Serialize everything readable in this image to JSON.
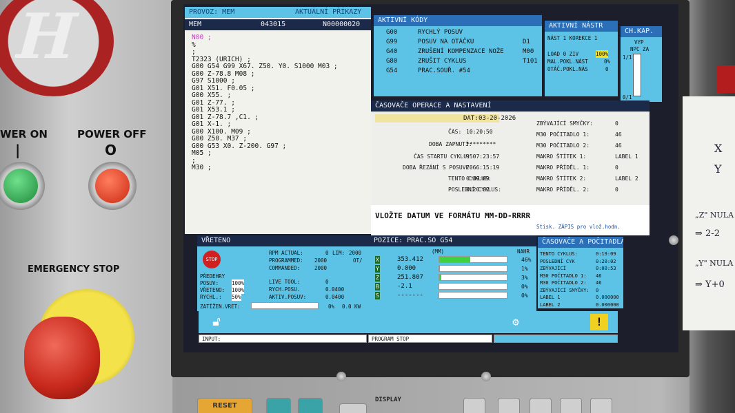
{
  "machine_panel": {
    "power_on_label": "WER ON",
    "power_on_symbol": "|",
    "power_off_label": "POWER OFF",
    "power_off_symbol": "O",
    "emergency_stop_label": "EMERGENCY STOP"
  },
  "program": {
    "mode_header": "PROVOZ: MEM",
    "mode_header_right": "AKTUÁLNÍ PŘÍKAZY",
    "bar_left": "MEM",
    "program_number": "043015",
    "sequence": "N00000020",
    "lines": [
      "N00 ;",
      "%",
      ";",
      "T2323 (URICH) ;",
      "G00 G54 G99 X67. Z50. Y0. S1000 M03 ;",
      "G00 Z-78.8 M08 ;",
      "G97 S1000 ;",
      "G01 X51. F0.05 ;",
      "G00 X55. ;",
      "G01 Z-77. ;",
      "G01 X53.1 ;",
      "G01 Z-78.7 ,C1. ;",
      "G01 X-1. ;",
      "G00 X100. M09 ;",
      "G00 Z50. M37 ;",
      "G00 G53 X0. Z-200. G97 ;",
      "M05 ;",
      ";",
      "M30 ;"
    ]
  },
  "active_codes": {
    "title": "AKTIVNÍ KÓDY",
    "rows": [
      {
        "code": "G00",
        "desc": "RYCHLÝ POSUV",
        "extra": ""
      },
      {
        "code": "G99",
        "desc": "POSUV NA OTÁČKU",
        "extra": "D1"
      },
      {
        "code": "G40",
        "desc": "ZRUŠENÍ KOMPENZACE NOŽE",
        "extra": "M00"
      },
      {
        "code": "G80",
        "desc": "ZRUŠIT CYKLUS",
        "extra": "T101"
      },
      {
        "code": "G54",
        "desc": "PRAC.SOUŘ. #54",
        "extra": ""
      }
    ]
  },
  "active_tool": {
    "title": "AKTIVNÍ NÁSTR",
    "line1": "NÁST 1  KOREKCE 1",
    "load_label": "LOAD 0  ZIV",
    "load_value": "100%",
    "line3": "MAL.POKL.NÁST",
    "line3_val": "0%",
    "line4": "OTÁČ.POKL.NÁS",
    "line4_val": "0"
  },
  "coolant": {
    "title": "CH.KAP.",
    "line1": "VYP",
    "line2": "NPC ZA",
    "scale_top": "1/1",
    "scale_bottom": "0/1"
  },
  "timers": {
    "title": "ČASOVAČE OPERACE A NASTAVENÍ",
    "date_label": "DAT:",
    "date_value": "03-20-2026",
    "rows_left": [
      {
        "label": "ČAS:",
        "value": "10:20:50"
      },
      {
        "label": "DOBA ZAPNUTÍ:",
        "value": "*********"
      },
      {
        "label": "ČAS STARTU CYKLU:",
        "value": "9507:23:57"
      },
      {
        "label": "DOBA ŘEZÁNÍ S POSUVE",
        "value": "7066:15:19"
      },
      {
        "label": "TENTO CYKLUS:",
        "value": "0:19:09"
      },
      {
        "label": "POSLEDNÍ CYKLUS:",
        "value": "0:20:02"
      }
    ],
    "rows_right": [
      {
        "label": "ZBÝVAJÍCÍ SMYČKY:",
        "value": "0"
      },
      {
        "label": "M30 POČITADLO 1:",
        "value": "46"
      },
      {
        "label": "M30 POČITADLO 2:",
        "value": "46"
      },
      {
        "label": "MAKRO ŠTÍTEK 1:",
        "value": "LABEL 1"
      },
      {
        "label": "MAKRO PŘÍDĚL. 1:",
        "value": "0"
      },
      {
        "label": "MAKRO ŠTÍTEK 2:",
        "value": "LABEL 2"
      },
      {
        "label": "MAKRO PŘÍDĚL. 2:",
        "value": "0"
      }
    ],
    "prompt": "VLOŽTE DATUM VE FORMÁTU MM-DD-RRRR",
    "prompt_hint": "Stisk. ZÁPIS pro vlož.hodn."
  },
  "spindle": {
    "title": "VŘETENO",
    "stop_label": "STOP",
    "predehry": "PŘEDEHRY",
    "overrides": [
      {
        "label": "POSUV:",
        "value": "100%"
      },
      {
        "label": "VŘETENO:",
        "value": "100%"
      },
      {
        "label": "RYCHL.:",
        "value": "50%"
      }
    ],
    "rpm_actual_label": "RPM ACTUAL:",
    "rpm_actual": "0",
    "lim_label": "LIM:",
    "lim": "2000",
    "programmed_label": "PROGRAMMED:",
    "programmed": "2000",
    "ot_label": "OT/",
    "commanded_label": "COMMANDED:",
    "commanded": "2000",
    "live_tool_label": "LIVE TOOL:",
    "live_tool": "0",
    "rych_label": "RYCH.POSU.",
    "rych": "0.0400",
    "aktiv_label": "AKTIV.POSUV:",
    "aktiv": "0.0400",
    "load_label": "ZATÍŽEN.VRET:",
    "load_value": "0%",
    "load_kw": "0.0 KW"
  },
  "position": {
    "title": "POZICE: PRAC.SO G54",
    "unit": "(MM)",
    "load_header": "NAHR",
    "axes": [
      {
        "axis": "X",
        "value": "353.412",
        "load": "46%",
        "fill_pct": 46
      },
      {
        "axis": "Y",
        "value": "0.000",
        "load": "1%",
        "fill_pct": 1
      },
      {
        "axis": "Z",
        "value": "251.807",
        "load": "3%",
        "fill_pct": 3
      },
      {
        "axis": "B",
        "value": "-2.1",
        "load": "0%",
        "fill_pct": 0
      },
      {
        "axis": "S",
        "value": "-------",
        "load": "0%",
        "fill_pct": 0
      }
    ]
  },
  "counters": {
    "title": "ČASOVAČE A POČITADLA",
    "rows": [
      {
        "label": "TENTO CYKLUS:",
        "value": "0:19:09"
      },
      {
        "label": "POSLEDNÍ CYK",
        "value": "0:20:02"
      },
      {
        "label": "ZBÝVAJÍCÍ",
        "value": "0:00:53"
      },
      {
        "label": "M30 POČITADLO 1:",
        "value": "46"
      },
      {
        "label": "M30 POČITADLO 2:",
        "value": "46"
      },
      {
        "label": "ZBÝVAJÍCÍ SMYČKY:",
        "value": "0"
      },
      {
        "label": "LABEL 1",
        "value": "0.000000"
      },
      {
        "label": "LABEL 2",
        "value": "0.000000"
      }
    ]
  },
  "status": {
    "input_label": "INPUT:",
    "program_state": "PROGRAM STOP"
  },
  "keyboard": {
    "display_label": "DISPLAY",
    "reset_label": "RESET"
  },
  "note_paper": {
    "lines": [
      "X",
      "Y",
      "„Z\" NULA",
      "⇒ 2-2",
      "„Y\" NULA",
      "⇒ Y+0"
    ]
  },
  "colors": {
    "screen_blue": "#2a6fb8",
    "panel_cyan": "#5cc3e6",
    "status_green": "#3fd13f"
  }
}
